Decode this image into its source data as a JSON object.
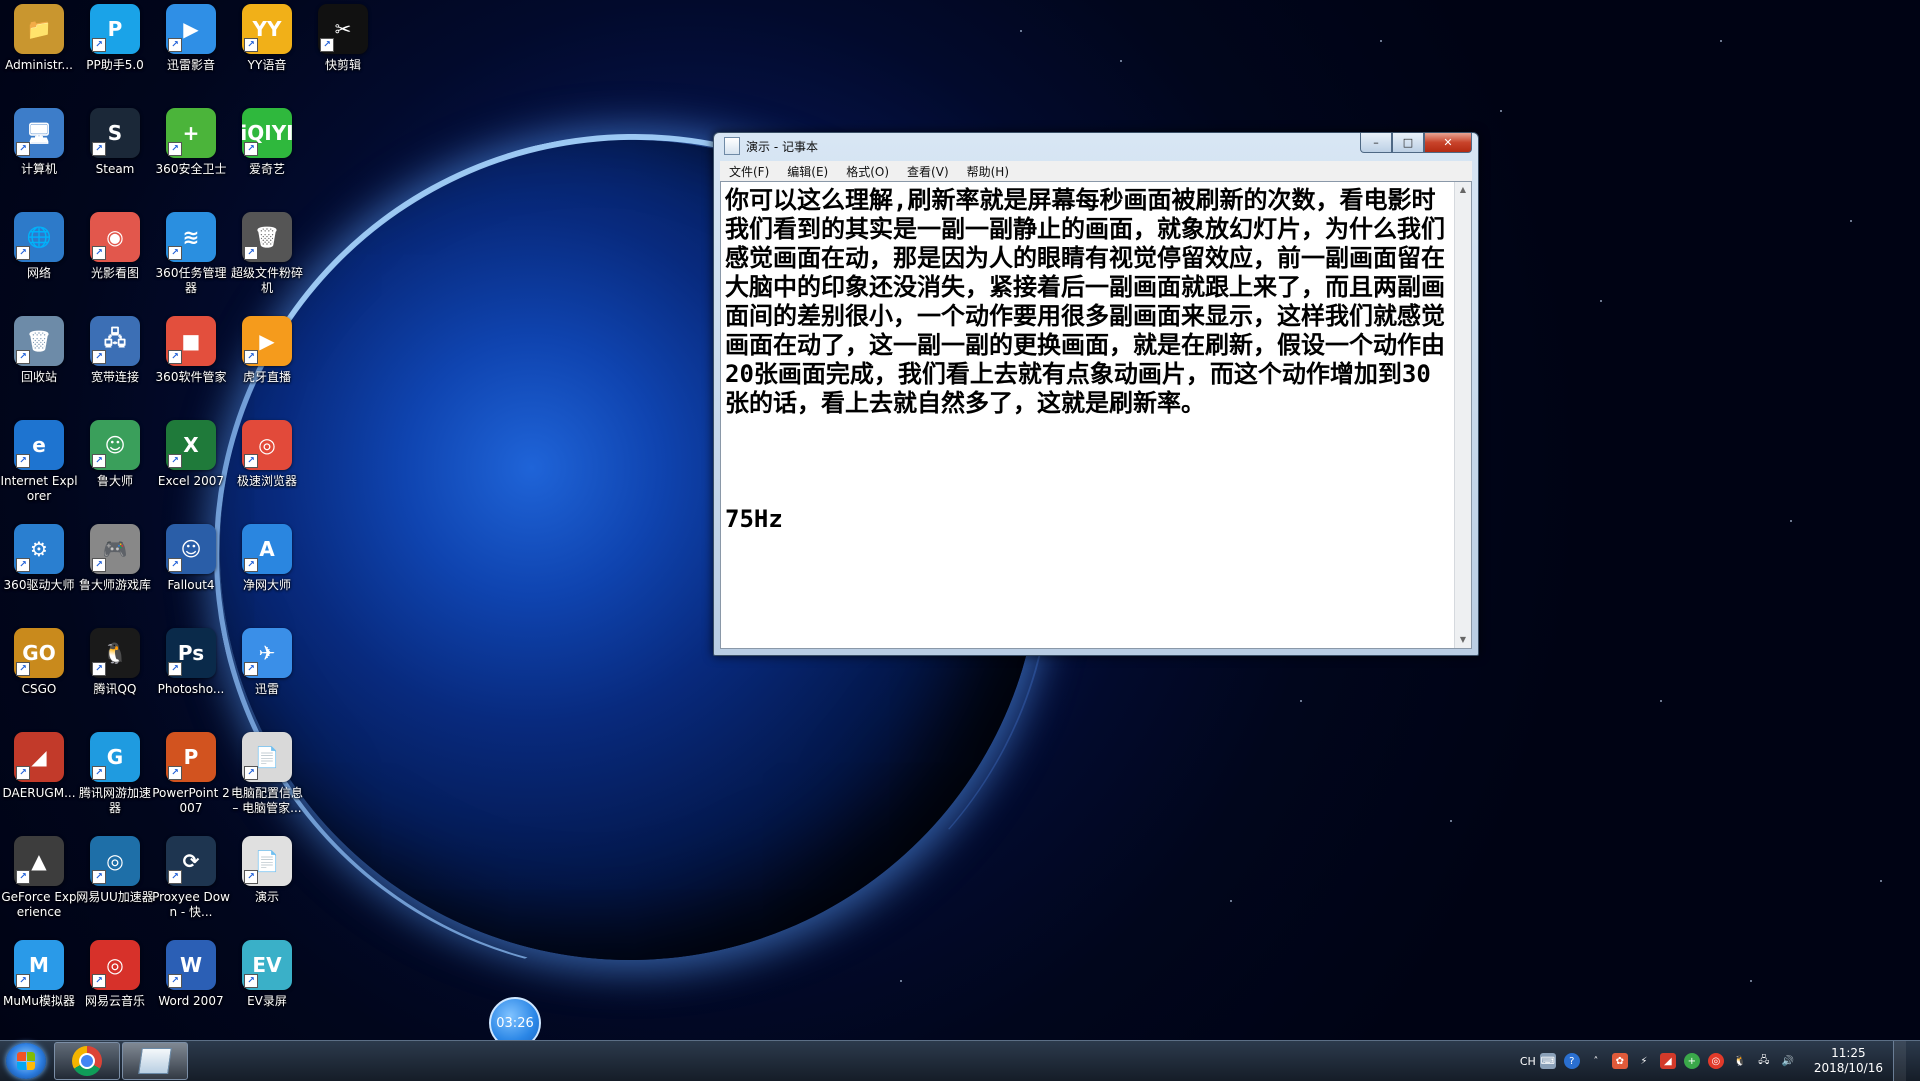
{
  "desktop": {
    "icons": [
      {
        "label": "Administr...",
        "glyph": "📁",
        "color": "#c9962f",
        "icon": "folder-icon"
      },
      {
        "label": "PP助手5.0",
        "glyph": "P",
        "color": "#1aa3e8",
        "icon": "pp-assistant-icon"
      },
      {
        "label": "迅雷影音",
        "glyph": "▶",
        "color": "#2f8fe6",
        "icon": "xunlei-player-icon"
      },
      {
        "label": "YY语音",
        "glyph": "YY",
        "color": "#f1b018",
        "icon": "yy-voice-icon"
      },
      {
        "label": "快剪辑",
        "glyph": "✂",
        "color": "#111111",
        "icon": "kuaijianji-icon"
      },
      {
        "label": "计算机",
        "glyph": "🖥",
        "color": "#3d7dc9",
        "icon": "computer-icon"
      },
      {
        "label": "Steam",
        "glyph": "S",
        "color": "#1b2838",
        "icon": "steam-icon"
      },
      {
        "label": "360安全卫士",
        "glyph": "+",
        "color": "#4bb43a",
        "icon": "360-security-icon"
      },
      {
        "label": "爱奇艺",
        "glyph": "iQIYI",
        "color": "#2fb83d",
        "icon": "iqiyi-icon"
      },
      {
        "label": "网络",
        "glyph": "🌐",
        "color": "#2d7ac9",
        "icon": "network-icon"
      },
      {
        "label": "光影看图",
        "glyph": "◉",
        "color": "#e2574c",
        "icon": "photo-viewer-icon"
      },
      {
        "label": "360任务管理器",
        "glyph": "≋",
        "color": "#2a8fe0",
        "icon": "task-manager-icon"
      },
      {
        "label": "超级文件粉碎机",
        "glyph": "🗑",
        "color": "#555555",
        "icon": "file-shredder-icon"
      },
      {
        "label": "回收站",
        "glyph": "🗑",
        "color": "#6d8ba8",
        "icon": "recycle-bin-icon"
      },
      {
        "label": "宽带连接",
        "glyph": "🖧",
        "color": "#3c6fb5",
        "icon": "broadband-icon"
      },
      {
        "label": "360软件管家",
        "glyph": "■",
        "color": "#e34f3d",
        "icon": "360-software-icon"
      },
      {
        "label": "虎牙直播",
        "glyph": "▶",
        "color": "#f59b1c",
        "icon": "huya-icon"
      },
      {
        "label": "Internet Explorer",
        "glyph": "e",
        "color": "#1e74d0",
        "icon": "ie-icon"
      },
      {
        "label": "鲁大师",
        "glyph": "☺",
        "color": "#3a9f5b",
        "icon": "ludashi-icon"
      },
      {
        "label": "Excel 2007",
        "glyph": "X",
        "color": "#1f7a3a",
        "icon": "excel-icon"
      },
      {
        "label": "极速浏览器",
        "glyph": "◎",
        "color": "#e24a3a",
        "icon": "browser-icon"
      },
      {
        "label": "360驱动大师",
        "glyph": "⚙",
        "color": "#2a7fd0",
        "icon": "driver-icon"
      },
      {
        "label": "鲁大师游戏库",
        "glyph": "🎮",
        "color": "#888888",
        "icon": "game-library-icon"
      },
      {
        "label": "Fallout4",
        "glyph": "☺",
        "color": "#2a5ea8",
        "icon": "fallout-icon"
      },
      {
        "label": "净网大师",
        "glyph": "A",
        "color": "#2a86e0",
        "icon": "adsafe-icon"
      },
      {
        "label": "CSGO",
        "glyph": "GO",
        "color": "#c98a1c",
        "icon": "csgo-icon"
      },
      {
        "label": "腾讯QQ",
        "glyph": "🐧",
        "color": "#1a1a1a",
        "icon": "qq-icon"
      },
      {
        "label": "Photosho...",
        "glyph": "Ps",
        "color": "#0a2a4a",
        "icon": "photoshop-icon"
      },
      {
        "label": "迅雷",
        "glyph": "✈",
        "color": "#3a8fe8",
        "icon": "xunlei-icon"
      },
      {
        "label": "DAERUGM...",
        "glyph": "◢",
        "color": "#c23a2a",
        "icon": "daerugm-icon"
      },
      {
        "label": "腾讯网游加速器",
        "glyph": "G",
        "color": "#1f9be0",
        "icon": "game-accelerator-icon"
      },
      {
        "label": "PowerPoint 2007",
        "glyph": "P",
        "color": "#d2531f",
        "icon": "powerpoint-icon"
      },
      {
        "label": "电脑配置信息 – 电脑管家...",
        "glyph": "📄",
        "color": "#d9d9d9",
        "icon": "text-file-icon"
      },
      {
        "label": "GeForce Experience",
        "glyph": "▲",
        "color": "#3d3d3d",
        "icon": "geforce-icon"
      },
      {
        "label": "网易UU加速器",
        "glyph": "◎",
        "color": "#1e6fa8",
        "icon": "uu-accelerator-icon"
      },
      {
        "label": "Proxyee Down - 快...",
        "glyph": "⟳",
        "color": "#1e3550",
        "icon": "proxyee-icon"
      },
      {
        "label": "演示",
        "glyph": "📄",
        "color": "#e0e0e0",
        "icon": "text-file-icon"
      },
      {
        "label": "MuMu模拟器",
        "glyph": "M",
        "color": "#2a9ae8",
        "icon": "mumu-icon"
      },
      {
        "label": "网易云音乐",
        "glyph": "◎",
        "color": "#d7312a",
        "icon": "netease-music-icon"
      },
      {
        "label": "Word 2007",
        "glyph": "W",
        "color": "#2b5fb5",
        "icon": "word-icon"
      },
      {
        "label": "EV录屏",
        "glyph": "EV",
        "color": "#3ab0c8",
        "icon": "ev-recorder-icon"
      }
    ]
  },
  "notepad": {
    "title": "演示 - 记事本",
    "menu": [
      "文件(F)",
      "编辑(E)",
      "格式(O)",
      "查看(V)",
      "帮助(H)"
    ],
    "content": "你可以这么理解,刷新率就是屏幕每秒画面被刷新的次数，看电影时我们看到的其实是一副一副静止的画面，就象放幻灯片，为什么我们感觉画面在动，那是因为人的眼睛有视觉停留效应，前一副画面留在大脑中的印象还没消失，紧接着后一副画面就跟上来了，而且两副画面间的差别很小，一个动作要用很多副画面来显示，这样我们就感觉画面在动了，这一副一副的更换画面，就是在刷新，假设一个动作由20张画面完成，我们看上去就有点象动画片，而这个动作增加到30张的话，看上去就自然多了，这就是刷新率。\n\n\n\n75Hz",
    "buttons": {
      "minimize": "–",
      "maximize": "□",
      "close": "✕"
    }
  },
  "timer": "03:26",
  "taskbar": {
    "tray_language": "CH",
    "time": "11:25",
    "date": "2018/10/16"
  }
}
